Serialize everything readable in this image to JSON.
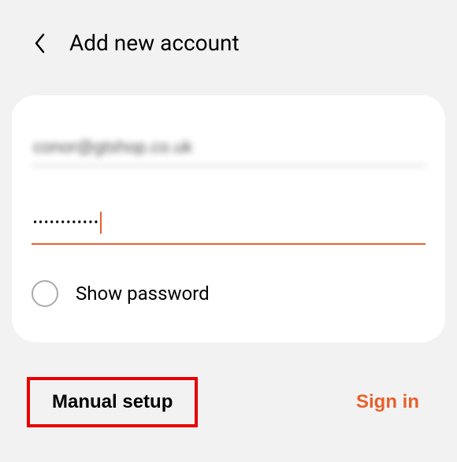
{
  "header": {
    "title": "Add new account"
  },
  "form": {
    "email_value": "conor@gtshop.co.uk",
    "password_dots": "••••••••••••",
    "show_password_label": "Show password"
  },
  "buttons": {
    "manual_setup": "Manual setup",
    "sign_in": "Sign in"
  },
  "colors": {
    "accent": "#e8602c",
    "highlight": "#e60000"
  }
}
